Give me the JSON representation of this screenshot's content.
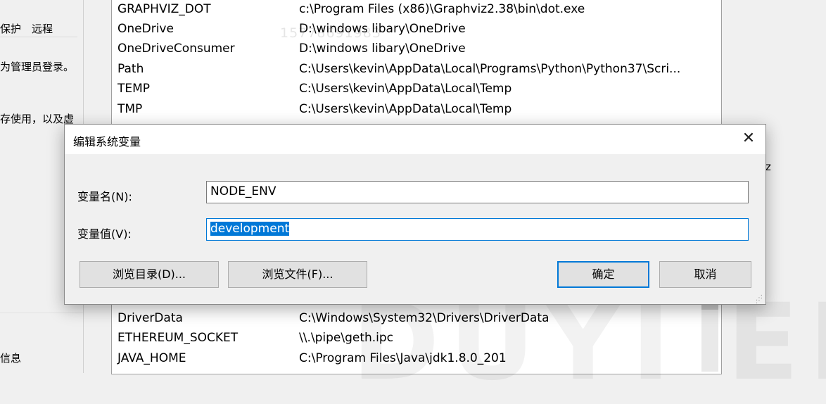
{
  "left_panel": {
    "tabs": [
      "保护",
      "远程"
    ],
    "texts": [
      "为管理员登录。",
      "存使用，以及虚",
      "信息"
    ]
  },
  "env_list": {
    "rows_top": [
      {
        "name": "GRAPHVIZ_DOT",
        "value": "c:\\Program Files (x86)\\Graphviz2.38\\bin\\dot.exe"
      },
      {
        "name": "OneDrive",
        "value": "D:\\windows libary\\OneDrive"
      },
      {
        "name": "OneDriveConsumer",
        "value": "D:\\windows libary\\OneDrive"
      },
      {
        "name": "Path",
        "value": "C:\\Users\\kevin\\AppData\\Local\\Programs\\Python\\Python37\\Scri..."
      },
      {
        "name": "TEMP",
        "value": "C:\\Users\\kevin\\AppData\\Local\\Temp"
      },
      {
        "name": "TMP",
        "value": "C:\\Users\\kevin\\AppData\\Local\\Temp"
      }
    ],
    "rows_bottom": [
      {
        "name": "DriverData",
        "value": "C:\\Windows\\System32\\Drivers\\DriverData"
      },
      {
        "name": "ETHEREUM_SOCKET",
        "value": "\\\\.\\pipe\\geth.ipc"
      },
      {
        "name": "JAVA_HOME",
        "value": "C:\\Program Files\\Java\\jdk1.8.0_201"
      }
    ],
    "side_fragment": "z"
  },
  "watermark": {
    "number": "15778691983",
    "brand": "DUYI EDUCA"
  },
  "dialog": {
    "title": "编辑系统变量",
    "close_icon": "close-icon",
    "name_label": "变量名(N):",
    "name_value": "NODE_ENV",
    "value_label": "变量值(V):",
    "value_value": "development",
    "browse_dir": "浏览目录(D)...",
    "browse_file": "浏览文件(F)...",
    "ok": "确定",
    "cancel": "取消"
  },
  "colors": {
    "accent": "#0078d7",
    "dialog_bg": "#f0f0f0",
    "button_bg": "#e1e1e1"
  }
}
